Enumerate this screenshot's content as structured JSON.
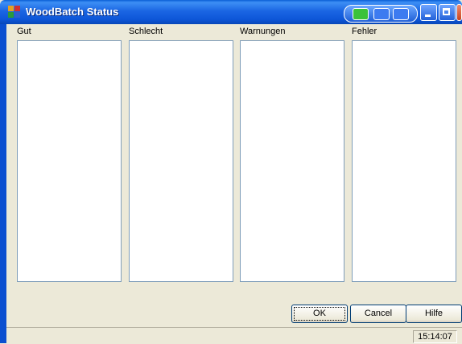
{
  "window": {
    "title": "WoodBatch Status",
    "icon": "app-grid-icon",
    "colors": {
      "titlebar": "#1b66e3",
      "close": "#c8431f"
    }
  },
  "columns": [
    {
      "label": "Gut",
      "items": []
    },
    {
      "label": "Schlecht",
      "items": []
    },
    {
      "label": "Warnungen",
      "items": []
    },
    {
      "label": "Fehler",
      "items": []
    }
  ],
  "buttons": {
    "ok": "OK",
    "cancel": "Cancel",
    "help": "Hilfe"
  },
  "status": {
    "time": "15:14:07"
  }
}
